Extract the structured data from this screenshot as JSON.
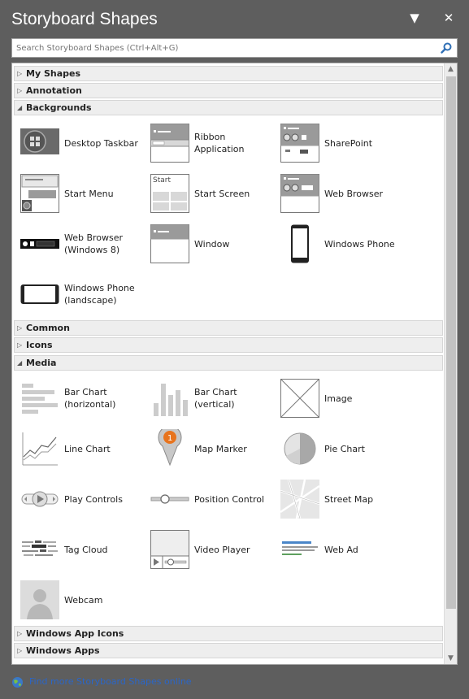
{
  "window": {
    "title": "Storyboard Shapes",
    "dropdown_icon": "triangle-down-icon",
    "close_icon": "close-icon"
  },
  "search": {
    "placeholder": "Search Storyboard Shapes (Ctrl+Alt+G)",
    "icon": "search-icon"
  },
  "sections": {
    "my_shapes": "My Shapes",
    "annotation": "Annotation",
    "backgrounds": "Backgrounds",
    "common": "Common",
    "icons": "Icons",
    "media": "Media",
    "windows_app_icons": "Windows App Icons",
    "windows_apps": "Windows Apps"
  },
  "backgrounds": {
    "desktop_taskbar": "Desktop Taskbar",
    "ribbon_application": "Ribbon\nApplication",
    "sharepoint": "SharePoint",
    "start_menu": "Start Menu",
    "start_screen": "Start Screen",
    "start_screen_thumb_text": "Start",
    "web_browser": "Web Browser",
    "web_browser_win8": "Web Browser\n(Windows 8)",
    "window": "Window",
    "windows_phone": "Windows Phone",
    "windows_phone_landscape": "Windows Phone\n(landscape)"
  },
  "media": {
    "bar_chart_horizontal": "Bar Chart\n(horizontal)",
    "bar_chart_vertical": "Bar Chart\n(vertical)",
    "image": "Image",
    "line_chart": "Line Chart",
    "map_marker": "Map Marker",
    "map_marker_number": "1",
    "pie_chart": "Pie Chart",
    "play_controls": "Play Controls",
    "position_control": "Position Control",
    "street_map": "Street Map",
    "tag_cloud": "Tag Cloud",
    "video_player": "Video Player",
    "web_ad": "Web Ad",
    "webcam": "Webcam"
  },
  "footer": {
    "link": "Find more Storyboard Shapes online"
  },
  "colors": {
    "background": "#5e5e5e",
    "panel": "#ffffff",
    "link": "#2a66c8",
    "marker": "#e8741e"
  }
}
